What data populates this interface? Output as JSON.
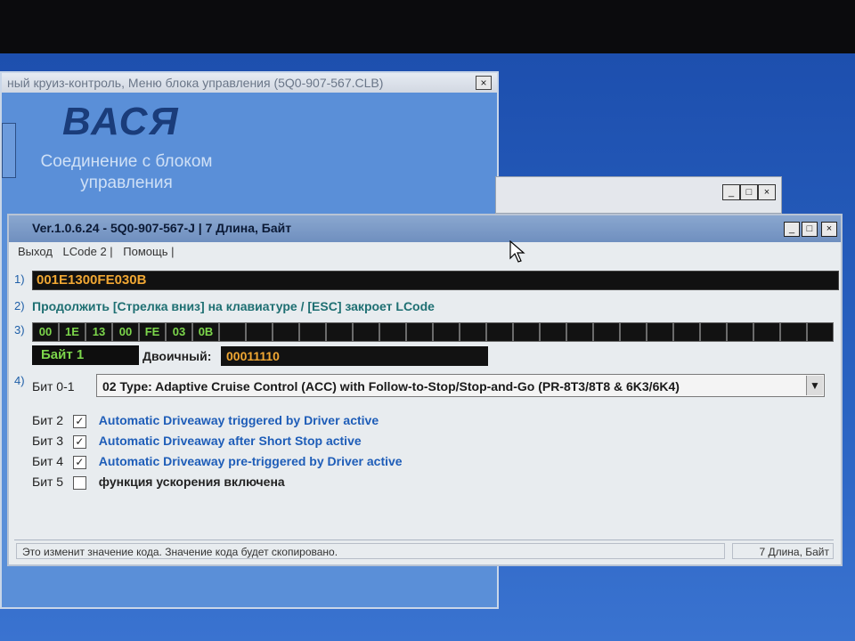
{
  "background_window": {
    "title": "ный круиз-контроль, Меню блока управления (5Q0-907-567.CLB)",
    "close": "×",
    "brand": "ВАСЯ",
    "connection_text": "Соединение с блоком управления"
  },
  "back_small_window": {
    "min": "_",
    "max": "□",
    "close": "×"
  },
  "dialog": {
    "title": "Ver.1.0.6.24 -   5Q0-907-567-J | 7 Длина, Байт",
    "controls": {
      "min": "_",
      "max": "□",
      "close": "×"
    },
    "menu": [
      "Выход",
      "LCode 2 |",
      "Помощь |"
    ],
    "labels": {
      "n1": "1)",
      "n2": "2)",
      "n3": "3)",
      "n4": "4)"
    },
    "lcode": "001E1300FE030B",
    "instruction": "Продолжить [Стрелка вниз] на клавиатуре / [ESC] закроет LCode",
    "bytes": [
      "00",
      "1E",
      "13",
      "00",
      "FE",
      "03",
      "0B"
    ],
    "empty_byte_cells": 23,
    "byte_label": "Байт 1",
    "binary_label": "Двоичный:",
    "binary_value": "00011110",
    "bit01_label": "Бит 0-1",
    "bit01_value": "02 Type: Adaptive Cruise Control (ACC) with Follow-to-Stop/Stop-and-Go (PR-8T3/8T8 & 6K3/6K4)",
    "bits": [
      {
        "name": "Бит 2",
        "checked": true,
        "text": "Automatic Driveaway triggered by Driver active"
      },
      {
        "name": "Бит 3",
        "checked": true,
        "text": "Automatic Driveaway after Short Stop active"
      },
      {
        "name": "Бит 4",
        "checked": true,
        "text": "Automatic Driveaway pre-triggered by Driver active"
      },
      {
        "name": "Бит 5",
        "checked": false,
        "text": "функция ускорения включена"
      }
    ],
    "status_left": "Это изменит значение кода.  Значение кода будет скопировано.",
    "status_right": "7 Длина, Байт"
  },
  "colors": {
    "byte_text": "#7cd64b",
    "code_text": "#f0a733",
    "blue_text": "#1e5db8",
    "teal_text": "#1e6f72"
  }
}
